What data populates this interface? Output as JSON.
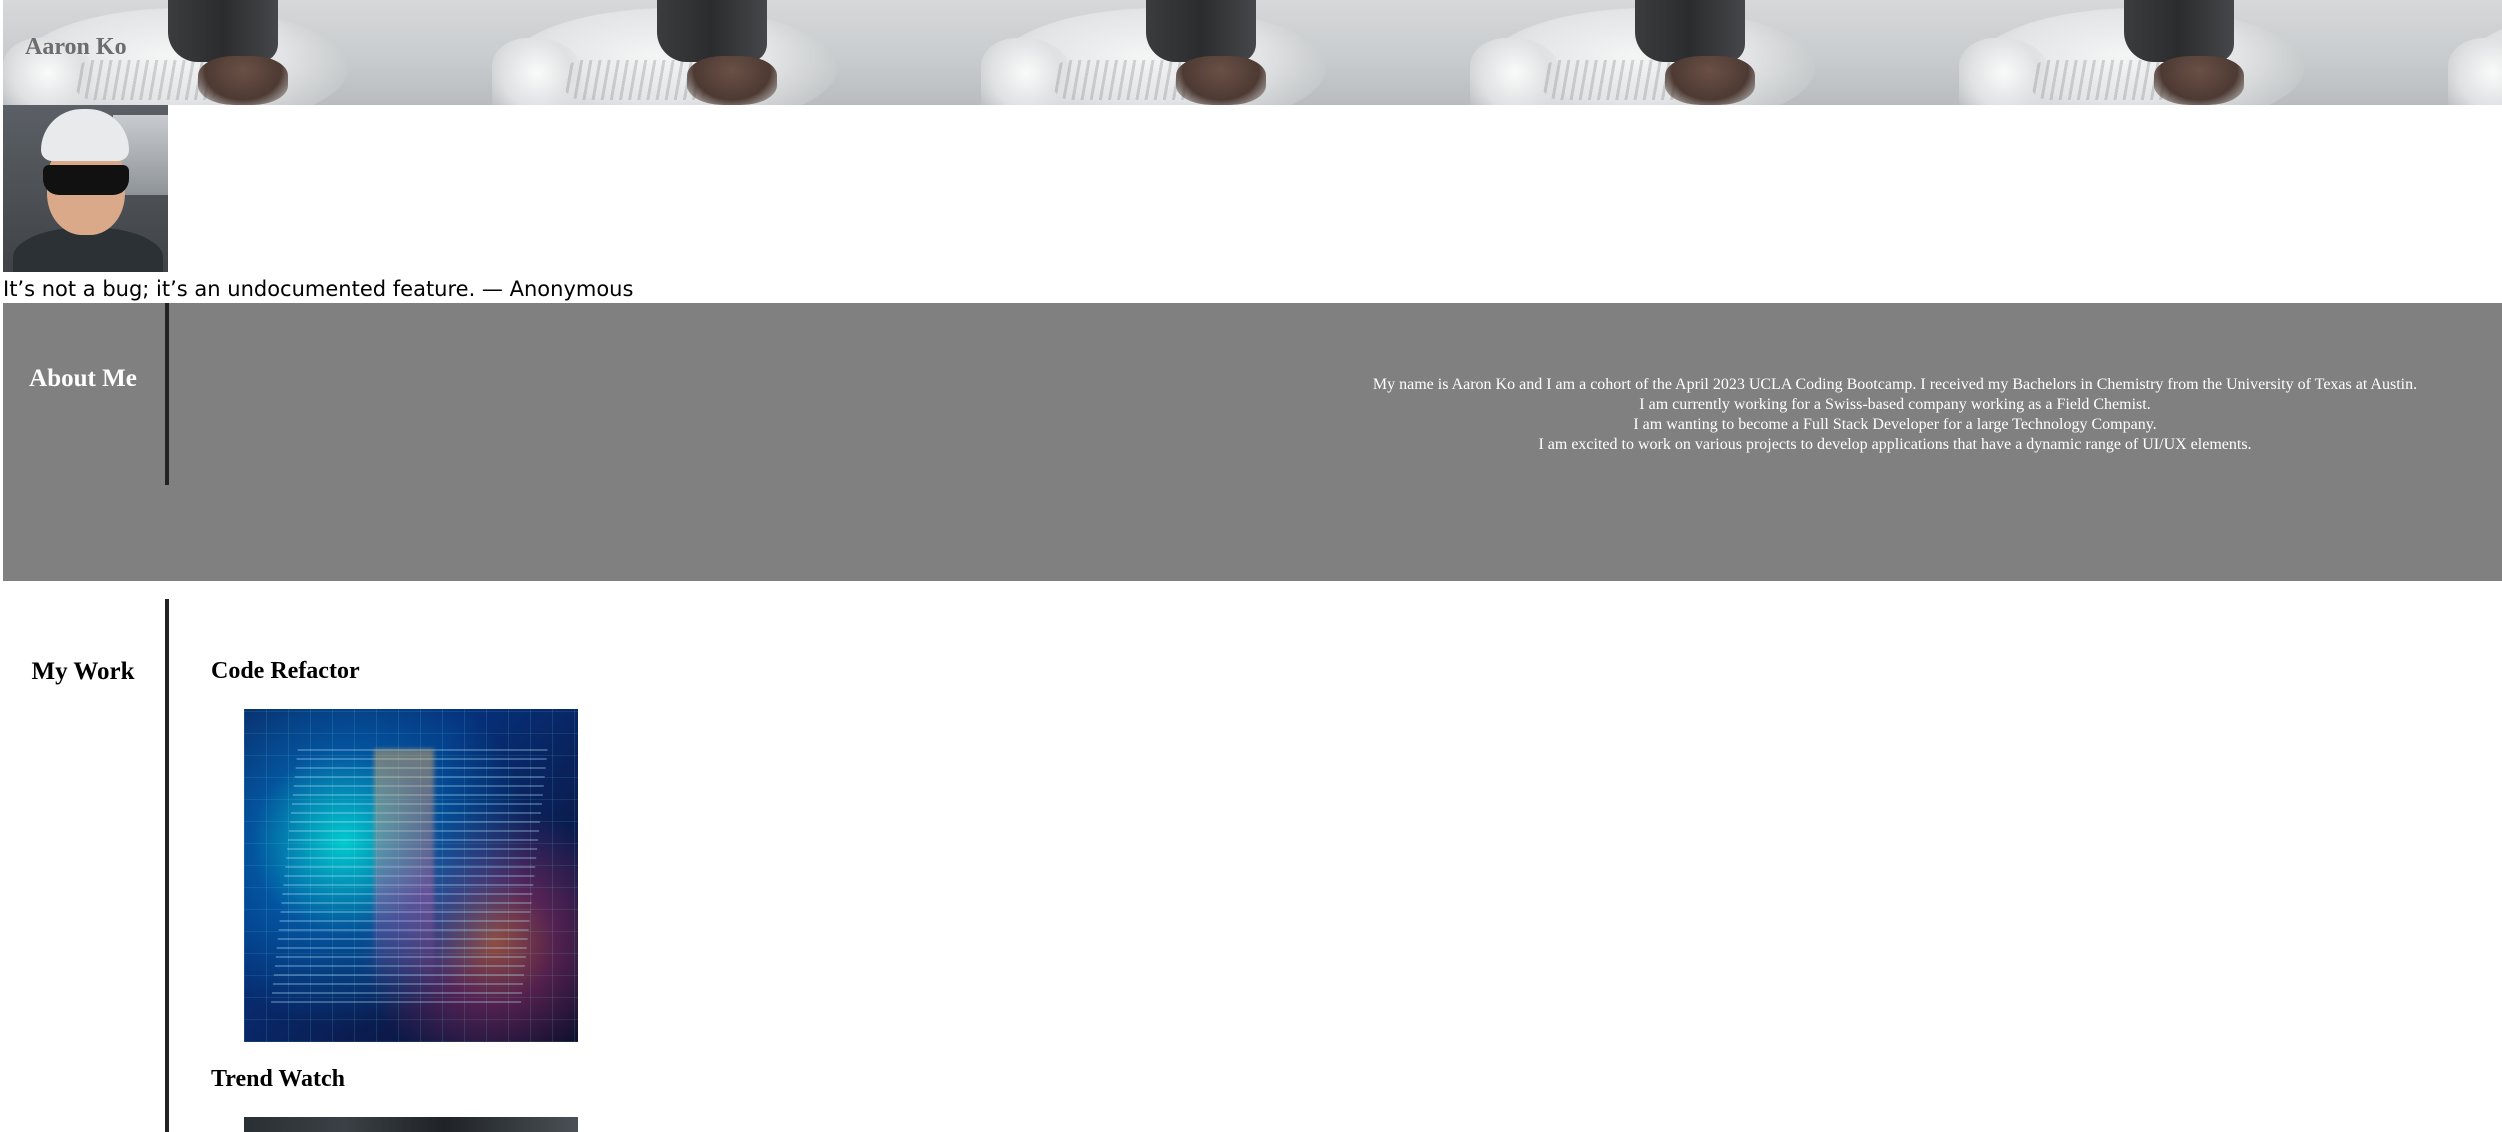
{
  "header": {
    "name": "Aaron Ko"
  },
  "quote": "It’s not a bug; it’s an undocumented feature. — Anonymous",
  "about": {
    "title": "About Me",
    "lines": [
      "My name is Aaron Ko and I am a cohort of the April 2023 UCLA Coding Bootcamp. I received my Bachelors in Chemistry from the University of Texas at Austin.",
      "I am currently working for a Swiss-based company working as a Field Chemist.",
      "I am wanting to become a Full Stack Developer for a large Technology Company.",
      "I am excited to work on various projects to develop applications that have a dynamic range of UI/UX elements."
    ]
  },
  "work": {
    "title": "My Work",
    "projects": [
      {
        "title": "Code Refactor"
      },
      {
        "title": "Trend Watch"
      }
    ]
  },
  "colors": {
    "about_background": "#808080",
    "divider": "#222222",
    "brand_text": "#6d6d6d"
  }
}
